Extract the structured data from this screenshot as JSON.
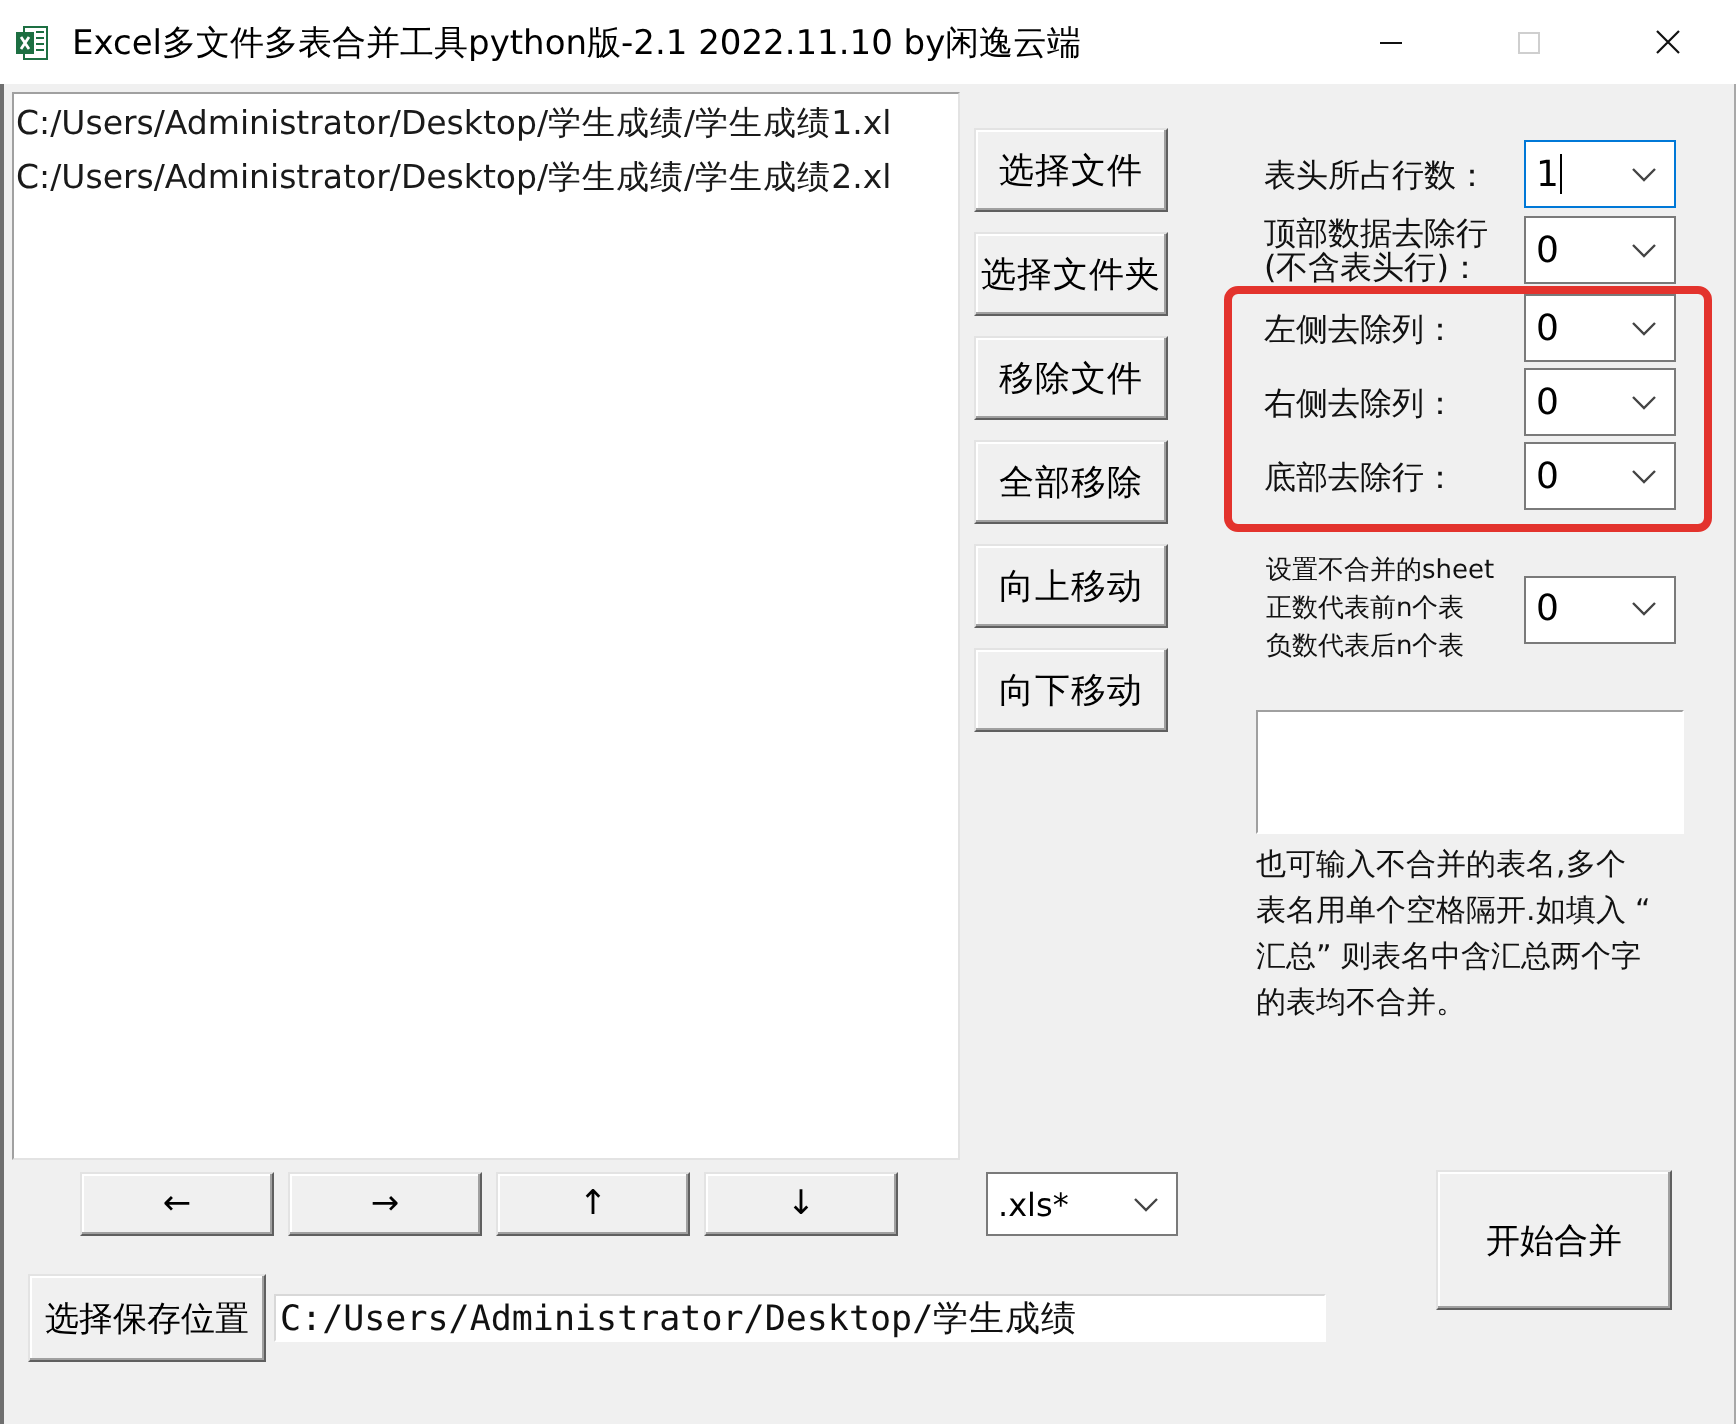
{
  "window": {
    "title": "Excel多文件多表合并工具python版-2.1 2022.11.10 by闲逸云端",
    "controls": [
      {
        "kind": "minimize",
        "disabled": false
      },
      {
        "kind": "maximize",
        "disabled": true
      },
      {
        "kind": "close",
        "disabled": false
      }
    ]
  },
  "file_list": {
    "items": [
      {
        "text": "C:/Users/Administrator/Desktop/学生成绩/学生成绩1.xl",
        "selected": false
      },
      {
        "text": "C:/Users/Administrator/Desktop/学生成绩/学生成绩2.xl",
        "selected": false
      }
    ]
  },
  "file_buttons": [
    "选择文件",
    "选择文件夹",
    "移除文件",
    "全部移除",
    "向上移动",
    "向下移动"
  ],
  "settings": [
    {
      "label": "表头所占行数：",
      "value": "1",
      "focused": true,
      "highlighted": false
    },
    {
      "label": "顶部数据去除行(不含表头行)：",
      "value": "0",
      "focused": false,
      "highlighted": false
    },
    {
      "label": "左侧去除列：",
      "value": "0",
      "focused": false,
      "highlighted": true
    },
    {
      "label": "右侧去除列：",
      "value": "0",
      "focused": false,
      "highlighted": true
    },
    {
      "label": "底部去除行：",
      "value": "0",
      "focused": false,
      "highlighted": true
    }
  ],
  "sheet_exclusion": {
    "label_lines": [
      "设置不合并的sheet",
      "正数代表前n个表",
      "负数代表后n个表"
    ],
    "value": "0",
    "note": "也可输入不合并的表名,多个表名用单个空格隔开.如填入 “汇总” 则表名中含汇总两个字的表均不合并。"
  },
  "nav_buttons": [
    "←",
    "→",
    "↑",
    "↓"
  ],
  "file_type": {
    "value": ".xls*"
  },
  "save_location": {
    "button": "选择保存位置",
    "path": "C:/Users/Administrator/Desktop/学生成绩"
  },
  "merge_button": "开始合并"
}
